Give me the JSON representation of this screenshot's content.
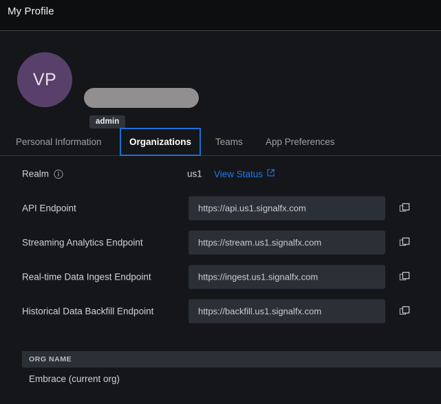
{
  "header": {
    "title": "My Profile"
  },
  "profile": {
    "avatar_initials": "VP",
    "avatar_color": "#58406b",
    "name_redacted": true,
    "role_badge": "admin"
  },
  "tabs": [
    {
      "label": "Personal Information",
      "active": false,
      "focused": false
    },
    {
      "label": "Organizations",
      "active": true,
      "focused": true
    },
    {
      "label": "Teams",
      "active": false,
      "focused": false
    },
    {
      "label": "App Preferences",
      "active": false,
      "focused": false
    }
  ],
  "realm_row": {
    "label": "Realm",
    "info_icon": "info-icon",
    "value": "us1",
    "link_label": "View Status",
    "link_icon": "external-link-icon",
    "link_color": "#2079e8"
  },
  "endpoints": [
    {
      "label": "API Endpoint",
      "value": "https://api.us1.signalfx.com",
      "copy_icon": "copy-icon"
    },
    {
      "label": "Streaming Analytics Endpoint",
      "value": "https://stream.us1.signalfx.com",
      "copy_icon": "copy-icon"
    },
    {
      "label": "Real-time Data Ingest Endpoint",
      "value": "https://ingest.us1.signalfx.com",
      "copy_icon": "copy-icon"
    },
    {
      "label": "Historical Data Backfill Endpoint",
      "value": "https://backfill.us1.signalfx.com",
      "copy_icon": "copy-icon"
    }
  ],
  "org_table": {
    "columns": [
      "ORG NAME"
    ],
    "rows": [
      {
        "name": "Embrace (current org)"
      }
    ]
  }
}
